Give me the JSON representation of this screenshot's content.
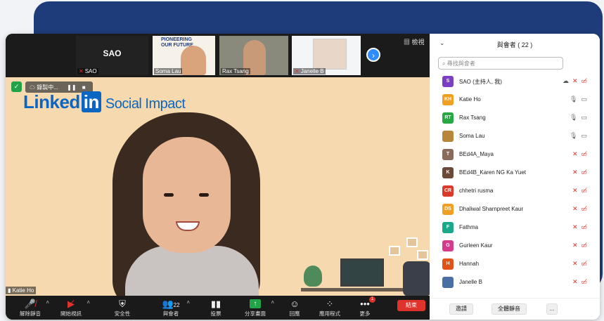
{
  "strip": {
    "tiles": [
      {
        "name": "SAO",
        "big": "SAO",
        "muted": true
      },
      {
        "name": "Soma Lau",
        "muted": false,
        "overlay": "PIONEERING OUR FUTURE"
      },
      {
        "name": "Rax Tsang",
        "muted": false
      },
      {
        "name": "Janelle B",
        "muted": true
      }
    ],
    "view_label": "檢視",
    "next_icon": "chevron-right-icon"
  },
  "main": {
    "recording_label": "錄製中...",
    "logo_word": "Linked",
    "logo_box": "in",
    "logo_tail": "Social Impact",
    "speaker_name": "Katie Ho"
  },
  "toolbar": {
    "items": [
      {
        "label": "解除靜音",
        "icon": "mic-muted-icon"
      },
      {
        "label": "開始視訊",
        "icon": "video-off-icon"
      },
      {
        "label": "安全性",
        "icon": "shield-icon"
      },
      {
        "label": "與會者",
        "icon": "participants-icon",
        "count": "22"
      },
      {
        "label": "投票",
        "icon": "poll-icon"
      },
      {
        "label": "分享畫面",
        "icon": "share-screen-icon"
      },
      {
        "label": "回應",
        "icon": "reaction-icon"
      },
      {
        "label": "應用程式",
        "icon": "apps-icon"
      },
      {
        "label": "更多",
        "icon": "more-icon",
        "badge": "1"
      }
    ],
    "end_label": "結束"
  },
  "panel": {
    "title": "與會者 ( 22 )",
    "search_placeholder": "尋找與會者",
    "participants": [
      {
        "initials": "S",
        "name": "SAO (主持人, 我)",
        "color": "#7b3fc4",
        "mic": "muted",
        "video": "off",
        "cloud": true
      },
      {
        "initials": "KH",
        "name": "Katie Ho",
        "color": "#f0a020",
        "mic": "on",
        "video": "on"
      },
      {
        "initials": "RT",
        "name": "Rax Tsang",
        "color": "#28a745",
        "mic": "on",
        "video": "on"
      },
      {
        "initials": "",
        "name": "Soma Lau",
        "color": "#b8863a",
        "mic": "on",
        "video": "on"
      },
      {
        "initials": "T",
        "name": "BEd4A_Maya",
        "color": "#8a6a5a",
        "mic": "muted",
        "video": "off"
      },
      {
        "initials": "K",
        "name": "BEd4B_Karen NG Ka Yuet",
        "color": "#6b4a3a",
        "mic": "muted",
        "video": "off"
      },
      {
        "initials": "CR",
        "name": "chhetri rusma",
        "color": "#d93a2b",
        "mic": "muted",
        "video": "off"
      },
      {
        "initials": "DS",
        "name": "Dhaliwal Sharnpreet Kaur",
        "color": "#f0a020",
        "mic": "muted",
        "video": "off"
      },
      {
        "initials": "F",
        "name": "Fathma",
        "color": "#1aa88a",
        "mic": "muted",
        "video": "off"
      },
      {
        "initials": "G",
        "name": "Gurleen Kaur",
        "color": "#d63a8a",
        "mic": "muted",
        "video": "off"
      },
      {
        "initials": "H",
        "name": "Hannah",
        "color": "#e0541a",
        "mic": "muted",
        "video": "off"
      },
      {
        "initials": "",
        "name": "Janelle B",
        "color": "#4a6fa5",
        "mic": "muted",
        "video": "off"
      }
    ],
    "invite_label": "邀請",
    "mute_all_label": "全體靜音",
    "more_label": "..."
  }
}
